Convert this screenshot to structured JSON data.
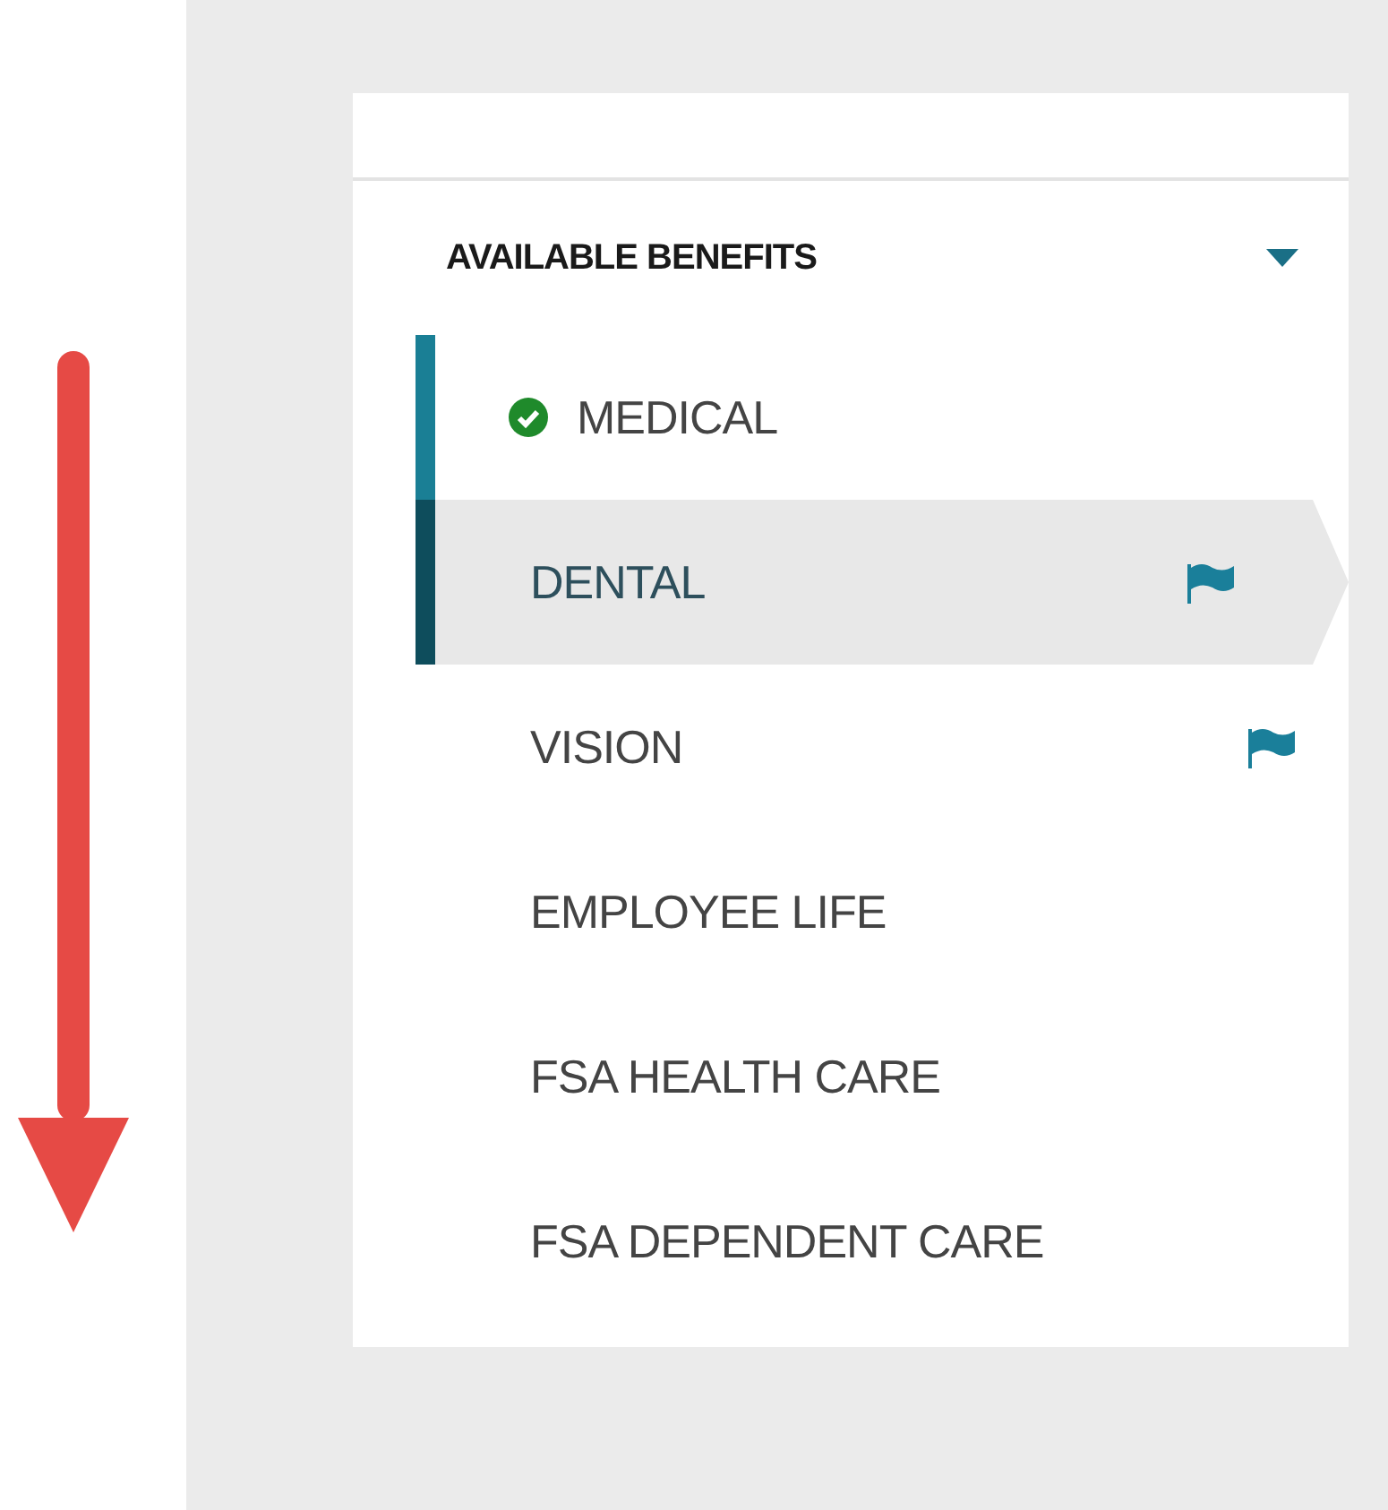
{
  "section": {
    "title": "AVAILABLE BENEFITS",
    "expanded": true
  },
  "benefits": [
    {
      "label": "MEDICAL",
      "completed": true,
      "selected": false,
      "flagged": false
    },
    {
      "label": "DENTAL",
      "completed": false,
      "selected": true,
      "flagged": true
    },
    {
      "label": "VISION",
      "completed": false,
      "selected": false,
      "flagged": true
    },
    {
      "label": "EMPLOYEE LIFE",
      "completed": false,
      "selected": false,
      "flagged": false
    },
    {
      "label": "FSA HEALTH CARE",
      "completed": false,
      "selected": false,
      "flagged": false
    },
    {
      "label": "FSA DEPENDENT CARE",
      "completed": false,
      "selected": false,
      "flagged": false
    }
  ]
}
